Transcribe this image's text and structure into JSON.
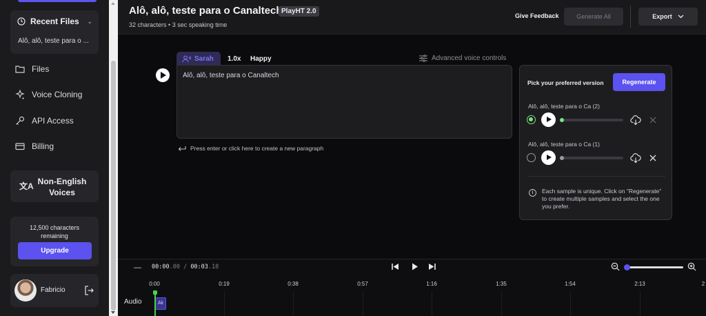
{
  "sidebar": {
    "recent_files": {
      "title": "Recent Files",
      "item": "Alô, alô, teste para o ..."
    },
    "nav": [
      {
        "label": "Files",
        "icon": "folder-icon"
      },
      {
        "label": "Voice Cloning",
        "icon": "sparkles-icon"
      },
      {
        "label": "API Access",
        "icon": "key-icon"
      },
      {
        "label": "Billing",
        "icon": "card-icon"
      }
    ],
    "non_english": {
      "label": "Non-English Voices",
      "icon": "translate-icon"
    },
    "quota": {
      "text": "12,500 characters remaining",
      "upgrade_label": "Upgrade"
    },
    "user": {
      "name": "Fabricio"
    }
  },
  "header": {
    "title": "Alô, alô, teste para o Canaltech",
    "badge": "PlayHT 2.0",
    "characters": "32 characters",
    "speaking_time": "• 3 sec speaking time",
    "feedback_label": "Give Feedback",
    "generate_all_label": "Generate All",
    "export_label": "Export"
  },
  "editor": {
    "voice": "Sarah",
    "speed": "1.0x",
    "emotion": "Happy",
    "advanced_label": "Advanced voice controls",
    "text": "Alô, alô, teste para o Canaltech",
    "hint": "Press enter or click here to create a new paragraph"
  },
  "versions": {
    "title": "Pick your preferred version",
    "regenerate_label": "Regenerate",
    "samples": [
      {
        "label": "Alô, alô, teste para o Ca (2)",
        "selected": true,
        "progress": 0
      },
      {
        "label": "Alô, alô, teste para o Ca (1)",
        "selected": false,
        "progress": 0
      }
    ],
    "info": "Each sample is unique. Click on \"Regenerate\" to create multiple samples and select the one you prefer."
  },
  "timeline": {
    "current_main": "00:00",
    "current_ms": ".00",
    "separator": " / ",
    "total_main": "00:03",
    "total_ms": ".18",
    "ticks": [
      "0:00",
      "0:19",
      "0:38",
      "0:57",
      "1:16",
      "1:35",
      "1:54",
      "2:13",
      "2"
    ],
    "track_label": "Audio",
    "clip_label": "Ak",
    "zoom_level": 0.05
  },
  "colors": {
    "accent": "#5b52ef",
    "selected": "#7de37e",
    "playhead": "#45d44a"
  }
}
